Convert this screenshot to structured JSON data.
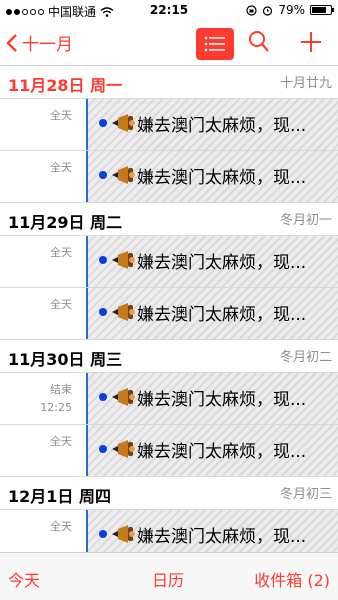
{
  "status_bar": {
    "carrier": "中国联通",
    "time": "22:15",
    "battery": "79%",
    "battery_level": 0.79
  },
  "nav": {
    "back_label": "十一月",
    "list_icon": "list-icon",
    "search_icon": "search-icon",
    "add_icon": "plus-icon"
  },
  "days": [
    {
      "date": "11月28日 周一",
      "lunar": "十月廿九",
      "is_today": true,
      "events": [
        {
          "time": "全天",
          "title": "嫌去澳门太麻烦，现..."
        },
        {
          "time": "全天",
          "title": "嫌去澳门太麻烦，现..."
        }
      ]
    },
    {
      "date": "11月29日 周二",
      "lunar": "冬月初一",
      "is_today": false,
      "events": [
        {
          "time": "全天",
          "title": "嫌去澳门太麻烦，现..."
        },
        {
          "time": "全天",
          "title": "嫌去澳门太麻烦，现..."
        }
      ]
    },
    {
      "date": "11月30日 周三",
      "lunar": "冬月初二",
      "is_today": false,
      "events": [
        {
          "time": "结束",
          "time2": "12:25",
          "title": "嫌去澳门太麻烦，现..."
        },
        {
          "time": "全天",
          "title": "嫌去澳门太麻烦，现..."
        }
      ]
    },
    {
      "date": "12月1日 周四",
      "lunar": "冬月初三",
      "is_today": false,
      "events": [
        {
          "time": "全天",
          "title": "嫌去澳门太麻烦，现..."
        }
      ]
    }
  ],
  "tabbar": {
    "today": "今天",
    "calendars": "日历",
    "inbox": "收件箱 (2)"
  },
  "colors": {
    "accent": "#ff3b30",
    "event_bar": "#1e6fd9",
    "bullet": "#0a3fd8",
    "secondary_text": "#8e8e93"
  }
}
